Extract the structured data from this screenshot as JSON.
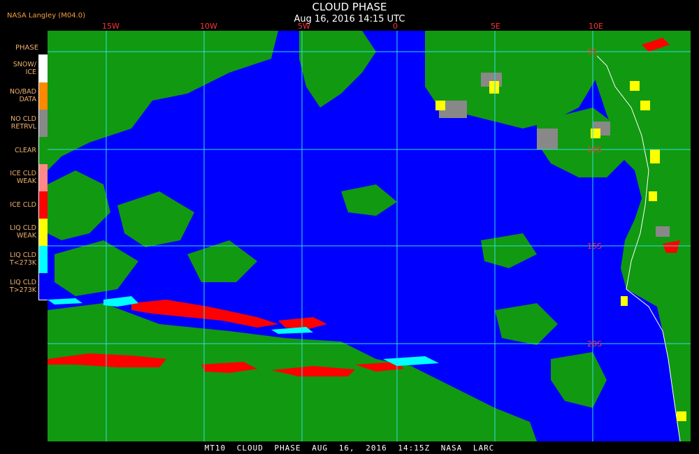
{
  "header": {
    "title": "CLOUD PHASE",
    "subtitle": "Aug 16, 2016 14:15 UTC",
    "provider": "NASA Langley (M04.0)"
  },
  "legend": {
    "title": "PHASE",
    "items": [
      {
        "label": "SNOW/\nICE",
        "color": "#ffffff"
      },
      {
        "label": "NO/BAD\nDATA",
        "color": "#ff8800"
      },
      {
        "label": "NO CLD\nRETRVL",
        "color": "#888888"
      },
      {
        "label": "CLEAR",
        "color": "#119911"
      },
      {
        "label": "ICE CLD\nWEAK",
        "color": "#ff8888"
      },
      {
        "label": "ICE CLD",
        "color": "#ff0000"
      },
      {
        "label": "LIQ CLD\nWEAK",
        "color": "#ffff00"
      },
      {
        "label": "LIQ CLD\nT<273K",
        "color": "#00ffff"
      },
      {
        "label": "LIQ CLD\nT>273K",
        "color": "#0000ff"
      }
    ]
  },
  "grid": {
    "lon_labels": [
      "15W",
      "10W",
      "5W",
      "0",
      "5E",
      "10E"
    ],
    "lat_labels": [
      "5S",
      "10S",
      "15S",
      "20S"
    ],
    "line_color": "#33dddd",
    "label_color": "#ff3333"
  },
  "footer": {
    "text": "MT10 CLOUD PHASE AUG 16, 2016 14:15Z NASA LARC"
  }
}
